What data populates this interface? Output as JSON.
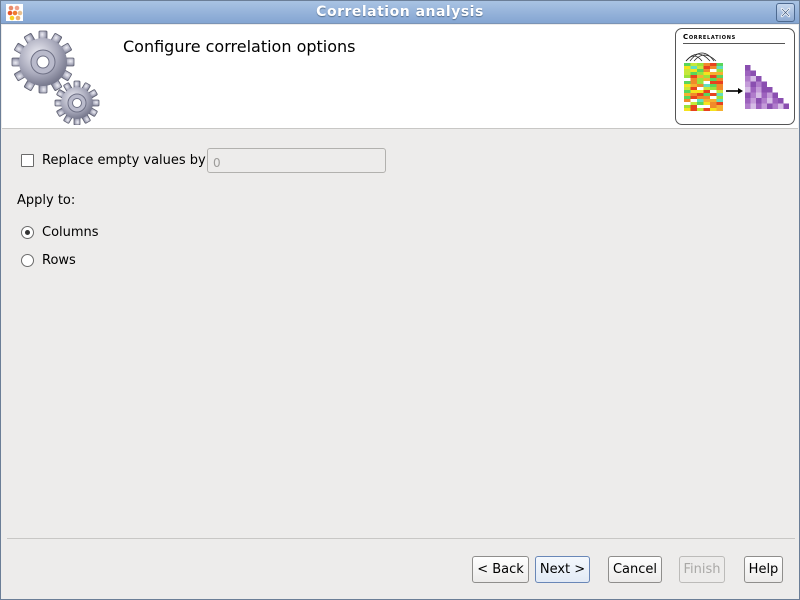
{
  "window": {
    "title": "Correlation analysis",
    "close_label": "×"
  },
  "header": {
    "title": "Configure correlation options",
    "thumbnail_title": "Correlations"
  },
  "options": {
    "replace_empty": {
      "label": "Replace empty values by",
      "checked": false,
      "value": "0"
    },
    "apply_to": {
      "label": "Apply to:",
      "options": [
        {
          "label": "Columns",
          "selected": true
        },
        {
          "label": "Rows",
          "selected": false
        }
      ]
    }
  },
  "buttons": {
    "back": "< Back",
    "next": "Next >",
    "cancel": "Cancel",
    "finish": "Finish",
    "help": "Help"
  },
  "colors": {
    "titlebar_top": "#a9c3e3",
    "titlebar_bottom": "#84a5d2",
    "background": "#edeceb",
    "default_button_border": "#6987b7"
  }
}
